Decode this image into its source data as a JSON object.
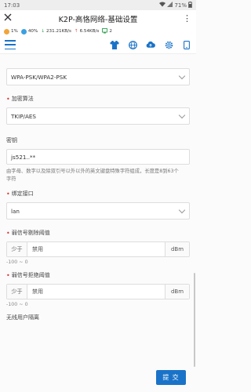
{
  "status_bar": {
    "time": "17:03",
    "battery": "71%"
  },
  "title_bar": {
    "title": "K2P-高恪网络-基础设置",
    "more": "⋮"
  },
  "info_bar": {
    "cpu": "1%",
    "memory": "40%",
    "down": "231.21KB/s",
    "up": "6.54KB/s",
    "clients": "2"
  },
  "form": {
    "security_mode_value": "WPA-PSK/WPA2-PSK",
    "encryption_label": "加密算法",
    "encryption_value": "TKIP/AES",
    "key_label": "密钥",
    "key_value": "js521..**",
    "key_help": "由字母、数字以及除双引号以外以外的英文键盘特殊字符组成，长度是8到63个字符",
    "bind_iface_label": "绑定接口",
    "bind_iface_value": "lan",
    "weak_remove_label": "弱信号剔除阈值",
    "weak_remove_prefix": "少于",
    "weak_remove_value": "禁用",
    "weak_remove_unit": "dBm",
    "weak_remove_hint": "-100 ~ 0",
    "weak_reject_label": "弱信号拒绝阈值",
    "weak_reject_prefix": "少于",
    "weak_reject_value": "禁用",
    "weak_reject_unit": "dBm",
    "weak_reject_hint": "-100 ~ 0",
    "wireless_isolation_label": "无线用户隔离"
  },
  "footer": {
    "submit_label": "提 交"
  },
  "colors": {
    "accent": "#1a73c8",
    "required": "#dd3333"
  }
}
